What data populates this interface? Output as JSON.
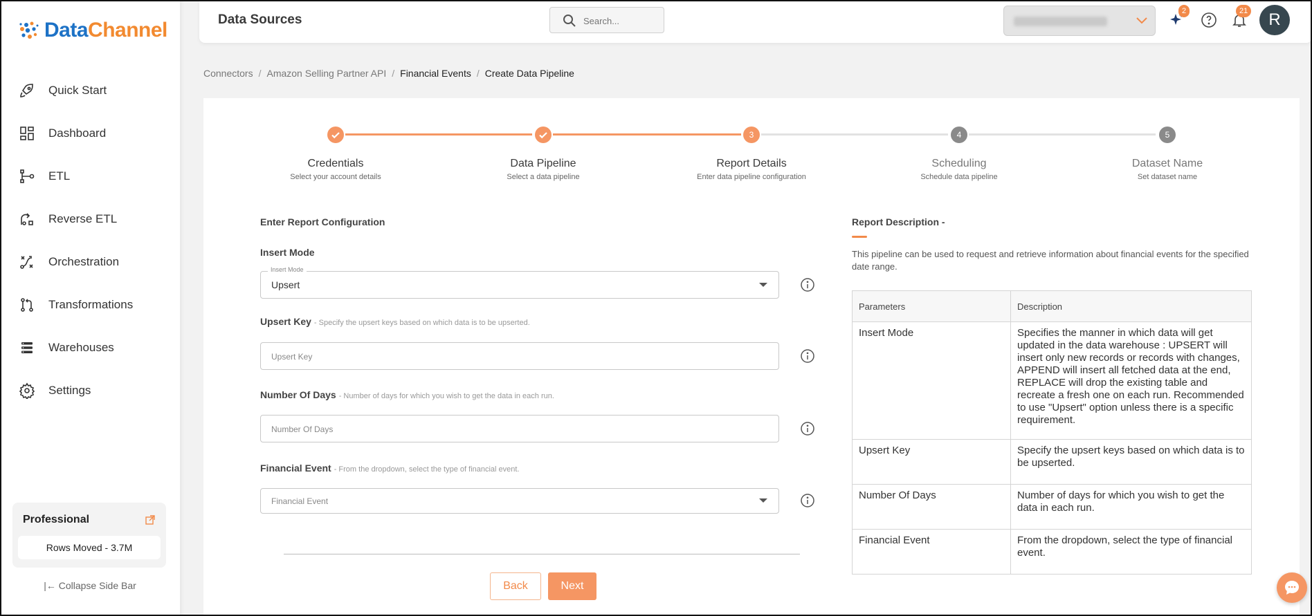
{
  "brand": {
    "name_part1": "Data",
    "name_part2": "Channel"
  },
  "sidebar": {
    "items": [
      {
        "label": "Quick Start",
        "icon": "rocket-icon"
      },
      {
        "label": "Dashboard",
        "icon": "dashboard-icon"
      },
      {
        "label": "ETL",
        "icon": "etl-icon"
      },
      {
        "label": "Reverse ETL",
        "icon": "reverse-etl-icon"
      },
      {
        "label": "Orchestration",
        "icon": "orchestration-icon"
      },
      {
        "label": "Transformations",
        "icon": "transformations-icon"
      },
      {
        "label": "Warehouses",
        "icon": "warehouses-icon"
      },
      {
        "label": "Settings",
        "icon": "gear-icon"
      }
    ],
    "plan": {
      "title": "Professional",
      "rows_moved": "Rows Moved - 3.7M"
    },
    "collapse_label": "Collapse Side Bar"
  },
  "header": {
    "title": "Data Sources",
    "search_placeholder": "Search...",
    "notifications": {
      "ai_count": "2",
      "bell_count": "21"
    },
    "avatar_initial": "R"
  },
  "breadcrumb": [
    "Connectors",
    "Amazon Selling Partner API",
    "Financial Events",
    "Create Data Pipeline"
  ],
  "steps": [
    {
      "number": "1",
      "title": "Credentials",
      "subtitle": "Select your account details",
      "status": "done"
    },
    {
      "number": "2",
      "title": "Data Pipeline",
      "subtitle": "Select a data pipeline",
      "status": "done"
    },
    {
      "number": "3",
      "title": "Report Details",
      "subtitle": "Enter data pipeline configuration",
      "status": "active"
    },
    {
      "number": "4",
      "title": "Scheduling",
      "subtitle": "Schedule data pipeline",
      "status": "pending"
    },
    {
      "number": "5",
      "title": "Dataset Name",
      "subtitle": "Set dataset name",
      "status": "pending"
    }
  ],
  "form": {
    "heading": "Enter Report Configuration",
    "insert_mode": {
      "label": "Insert Mode",
      "float_label": "Insert Mode",
      "value": "Upsert"
    },
    "upsert_key": {
      "label": "Upsert Key",
      "hint": "- Specify the upsert keys based on which data is to be upserted.",
      "placeholder": "Upsert Key"
    },
    "number_of_days": {
      "label": "Number Of Days",
      "hint": "- Number of days for which you wish to get the data in each run.",
      "placeholder": "Number Of Days"
    },
    "financial_event": {
      "label": "Financial Event",
      "hint": "- From the dropdown, select the type of financial event.",
      "placeholder": "Financial Event"
    },
    "back_label": "Back",
    "next_label": "Next"
  },
  "report": {
    "title": "Report Description -",
    "description": "This pipeline can be used to request and retrieve information about financial events for the specified date range.",
    "table_headers": [
      "Parameters",
      "Description"
    ],
    "rows": [
      {
        "name": "Insert Mode",
        "desc": "Specifies the manner in which data will get updated in the data warehouse : UPSERT will insert only new records or records with changes, APPEND will insert all fetched data at the end, REPLACE will drop the existing table and recreate a fresh one on each run. Recommended to use \"Upsert\" option unless there is a specific requirement."
      },
      {
        "name": "Upsert Key",
        "desc": "Specify the upsert keys based on which data is to be upserted."
      },
      {
        "name": "Number Of Days",
        "desc": "Number of days for which you wish to get the data in each run."
      },
      {
        "name": "Financial Event",
        "desc": "From the dropdown, select the type of financial event."
      }
    ]
  },
  "colors": {
    "accent": "#f28a4a",
    "brand_blue": "#1d72c6",
    "step_pending": "#8a8a8a"
  }
}
